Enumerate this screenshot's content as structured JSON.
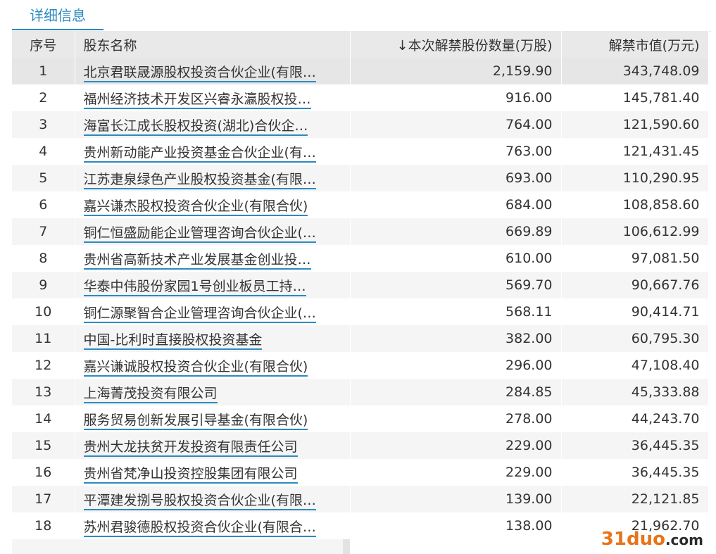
{
  "tab": {
    "label": "详细信息"
  },
  "table": {
    "headers": [
      "序号",
      "股东名称",
      "↓本次解禁股份数量(万股)",
      "解禁市值(万元)"
    ],
    "rows": [
      {
        "idx": "1",
        "name": "北京君联晟源股权投资合伙企业(有限…",
        "qty": "2,159.90",
        "value": "343,748.09"
      },
      {
        "idx": "2",
        "name": "福州经济技术开发区兴睿永瀛股权投…",
        "qty": "916.00",
        "value": "145,781.40"
      },
      {
        "idx": "3",
        "name": "海富长江成长股权投资(湖北)合伙企…",
        "qty": "764.00",
        "value": "121,590.60"
      },
      {
        "idx": "4",
        "name": "贵州新动能产业投资基金合伙企业(有…",
        "qty": "763.00",
        "value": "121,431.45"
      },
      {
        "idx": "5",
        "name": "江苏疌泉绿色产业股权投资基金(有限…",
        "qty": "693.00",
        "value": "110,290.95"
      },
      {
        "idx": "6",
        "name": "嘉兴谦杰股权投资合伙企业(有限合伙)",
        "qty": "684.00",
        "value": "108,858.60"
      },
      {
        "idx": "7",
        "name": "铜仁恒盛励能企业管理咨询合伙企业(…",
        "qty": "669.89",
        "value": "106,612.99"
      },
      {
        "idx": "8",
        "name": "贵州省高新技术产业发展基金创业投…",
        "qty": "610.00",
        "value": "97,081.50"
      },
      {
        "idx": "9",
        "name": "华泰中伟股份家园1号创业板员工持…",
        "qty": "569.70",
        "value": "90,667.76"
      },
      {
        "idx": "10",
        "name": "铜仁源聚智合企业管理咨询合伙企业(…",
        "qty": "568.11",
        "value": "90,414.71"
      },
      {
        "idx": "11",
        "name": "中国-比利时直接股权投资基金",
        "qty": "382.00",
        "value": "60,795.30"
      },
      {
        "idx": "12",
        "name": "嘉兴谦诚股权投资合伙企业(有限合伙)",
        "qty": "296.00",
        "value": "47,108.40"
      },
      {
        "idx": "13",
        "name": "上海菁茂投资有限公司",
        "qty": "284.85",
        "value": "45,333.88"
      },
      {
        "idx": "14",
        "name": "服务贸易创新发展引导基金(有限合伙)",
        "qty": "278.00",
        "value": "44,243.70"
      },
      {
        "idx": "15",
        "name": "贵州大龙扶贫开发投资有限责任公司",
        "qty": "229.00",
        "value": "36,445.35"
      },
      {
        "idx": "16",
        "name": "贵州省梵净山投资控股集团有限公司",
        "qty": "229.00",
        "value": "36,445.35"
      },
      {
        "idx": "17",
        "name": "平潭建发捌号股权投资合伙企业(有限…",
        "qty": "139.00",
        "value": "22,121.85"
      },
      {
        "idx": "18",
        "name": "苏州君骏德股权投资合伙企业(有限合…",
        "qty": "138.00",
        "value": "21,962.70"
      }
    ]
  },
  "watermark": {
    "num": "31",
    "brand": "duo",
    "dom": ".com"
  },
  "colors": {
    "accent": "#2a8bbf",
    "watermark": "#e7741a"
  }
}
